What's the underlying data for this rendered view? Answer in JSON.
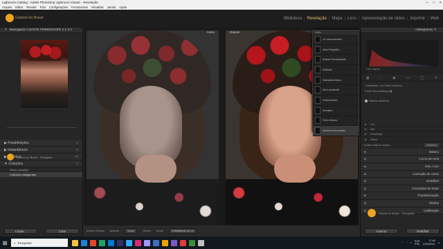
{
  "window": {
    "title": "Lightroom Catalog - Adobe Photoshop Lightroom Classic - Revelação",
    "controls": [
      "—",
      "□",
      "✕"
    ]
  },
  "menu": [
    "Arquivo",
    "Editar",
    "Revelar",
    "Foto",
    "Configurações",
    "Ferramentas",
    "Visualizar",
    "Janela",
    "Ajuda"
  ],
  "identity": {
    "brand": "Gabriel do Brasil"
  },
  "modules": {
    "items": [
      "Biblioteca",
      "Revelação",
      "Mapa",
      "Livro",
      "Apresentação de slides",
      "Imprimir",
      "Web"
    ],
    "active": "Revelação"
  },
  "left_panel": {
    "navigator": {
      "title": "Navegador",
      "zoom_options": "AJUSTE  PREENCHER  1:1  3:1"
    },
    "sections": [
      "Predefinições",
      "Instantâneos",
      "Histórico",
      "Coleções"
    ],
    "collections": [
      {
        "label": "Filtrar coleções",
        "selected": false
      },
      {
        "label": "Coleções inteligentes",
        "selected": true
      }
    ],
    "user_name": "Gabriel do Brasil",
    "user_note": "Fotografia",
    "buttons": {
      "copy": "Copiar...",
      "paste": "Colar"
    }
  },
  "center": {
    "before_label": "Antes",
    "after_label": "Depois"
  },
  "profile_browser": {
    "title": "Perfis",
    "items": [
      {
        "label": "Cor monocromática",
        "selected": false
      },
      {
        "label": "Muito Fotográfico",
        "selected": false
      },
      {
        "label": "Simples Personalização",
        "selected": false
      },
      {
        "label": "Estilizado",
        "selected": false
      },
      {
        "label": "Saturação artística",
        "selected": false
      },
      {
        "label": "Alto e penetrante",
        "selected": false
      },
      {
        "label": "Sombreamento",
        "selected": false
      },
      {
        "label": "Dramático",
        "selected": false
      },
      {
        "label": "Preto e Branco",
        "selected": false
      },
      {
        "label": "Modelo monocromático",
        "selected": true
      }
    ]
  },
  "right_panel": {
    "histogram_title": "Histograma",
    "histogram_info": "Foto original",
    "basic": {
      "tratamento_label": "Tratamento",
      "tratamento_options": "Cor   Preto e Branco",
      "perfil_label": "Perfil",
      "perfil_value": "Personalizado",
      "checkbox_label": "Nativos artísticos",
      "checked": true
    },
    "sub_rows": [
      "Cor",
      "Sat",
      "Presença",
      "Geral"
    ],
    "bottom_toolbar": {
      "label": "Ocultar todas as seções",
      "reset": "Redefinir"
    },
    "sections": [
      "Básico",
      "Curva de tons",
      "HSL / Cor",
      "Correção de cores",
      "Detalhes",
      "Correções de lente",
      "Transformação",
      "Efeitos",
      "Calibração"
    ],
    "user_name": "Gabriel do Brasil",
    "user_note": "Fotografia",
    "buttons": {
      "previous": "Anterior",
      "reset": "Redefinir"
    }
  },
  "bottom_toolbar": {
    "items": [
      "Antes e Depois",
      "Anterior",
      "Nome",
      "Ordem",
      "Nome",
      "Substituindo de cor"
    ]
  },
  "taskbar": {
    "search_placeholder": "Pesquisar",
    "time": "17:48",
    "date": "12/02/2021",
    "language": "POR\nPTB"
  },
  "colors": {
    "accent": "#f0a320",
    "active_module": "#e7c06b",
    "panel_bg": "#262626",
    "center_bg": "#1a1a1a"
  }
}
